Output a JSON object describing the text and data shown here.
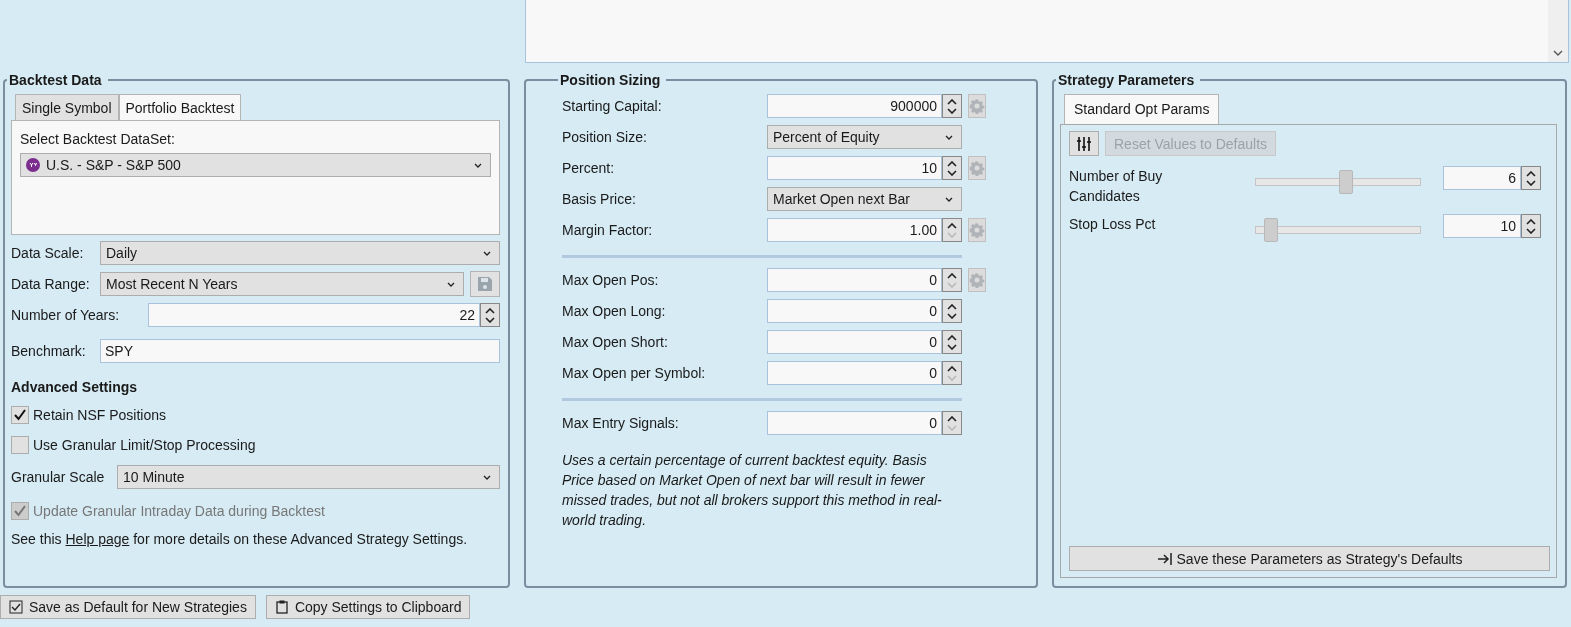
{
  "backtest_data": {
    "title": "Backtest Data",
    "tabs": [
      {
        "label": "Single Symbol",
        "selected": false
      },
      {
        "label": "Portfolio Backtest",
        "selected": true
      }
    ],
    "dataset_label": "Select Backtest DataSet:",
    "dataset": "U.S. - S&P - S&P 500",
    "data_scale": {
      "label": "Data Scale:",
      "value": "Daily"
    },
    "data_range": {
      "label": "Data Range:",
      "value": "Most Recent N Years"
    },
    "years": {
      "label": "Number of Years:",
      "value": "22"
    },
    "benchmark": {
      "label": "Benchmark:",
      "value": "SPY"
    },
    "advanced_title": "Advanced Settings",
    "options": [
      {
        "label": "Retain NSF Positions",
        "checked": true,
        "disabled": false
      },
      {
        "label": "Use Granular Limit/Stop Processing",
        "checked": false,
        "disabled": false
      }
    ],
    "granular_scale": {
      "label": "Granular Scale",
      "value": "10 Minute"
    },
    "update_option": {
      "label": "Update Granular Intraday Data during Backtest",
      "checked": true,
      "disabled": true
    },
    "help": {
      "before": "See this ",
      "link": "Help page",
      "after": " for more details on these Advanced Strategy Settings."
    }
  },
  "position_sizing": {
    "title": "Position Sizing",
    "groups": [
      [
        {
          "kind": "spin",
          "label": "Starting Capital:",
          "value": "900000",
          "gear": true,
          "down_disabled": false
        },
        {
          "kind": "dropdown",
          "label": "Position Size:",
          "value": "Percent of Equity"
        },
        {
          "kind": "spin",
          "label": "Percent:",
          "value": "10",
          "gear": true,
          "down_disabled": false
        },
        {
          "kind": "dropdown",
          "label": "Basis Price:",
          "value": "Market Open next Bar"
        },
        {
          "kind": "spin",
          "label": "Margin Factor:",
          "value": "1.00",
          "gear": true,
          "down_disabled": true
        }
      ],
      [
        {
          "kind": "spin",
          "label": "Max Open Pos:",
          "value": "0",
          "gear": true,
          "down_disabled": true
        },
        {
          "kind": "spin",
          "label": "Max Open Long:",
          "value": "0",
          "gear": false,
          "down_disabled": false
        },
        {
          "kind": "spin",
          "label": "Max Open Short:",
          "value": "0",
          "gear": false,
          "down_disabled": false
        },
        {
          "kind": "spin",
          "label": "Max Open per Symbol:",
          "value": "0",
          "gear": false,
          "down_disabled": true
        }
      ],
      [
        {
          "kind": "spin",
          "label": "Max Entry Signals:",
          "value": "0",
          "gear": false,
          "down_disabled": true
        }
      ]
    ],
    "description": "Uses a certain percentage of current backtest equity. Basis Price based on Market Open of next bar will result in fewer missed trades, but not all brokers support this method in real-world trading."
  },
  "strategy_parameters": {
    "title": "Strategy Parameters",
    "tabs": [
      {
        "label": "Standard Opt Params",
        "selected": true
      }
    ],
    "reset_button": {
      "label": "Reset Values to Defaults",
      "disabled": true
    },
    "params": [
      {
        "label": "Number of Buy Candidates",
        "level": 0.55,
        "value": "6"
      },
      {
        "label": "Stop Loss Pct",
        "level": 0.05,
        "value": "10"
      }
    ],
    "save_button": "Save these Parameters as Strategy's Defaults"
  },
  "footer_buttons": [
    "Save as Default for New Strategies",
    "Copy Settings to Clipboard"
  ]
}
